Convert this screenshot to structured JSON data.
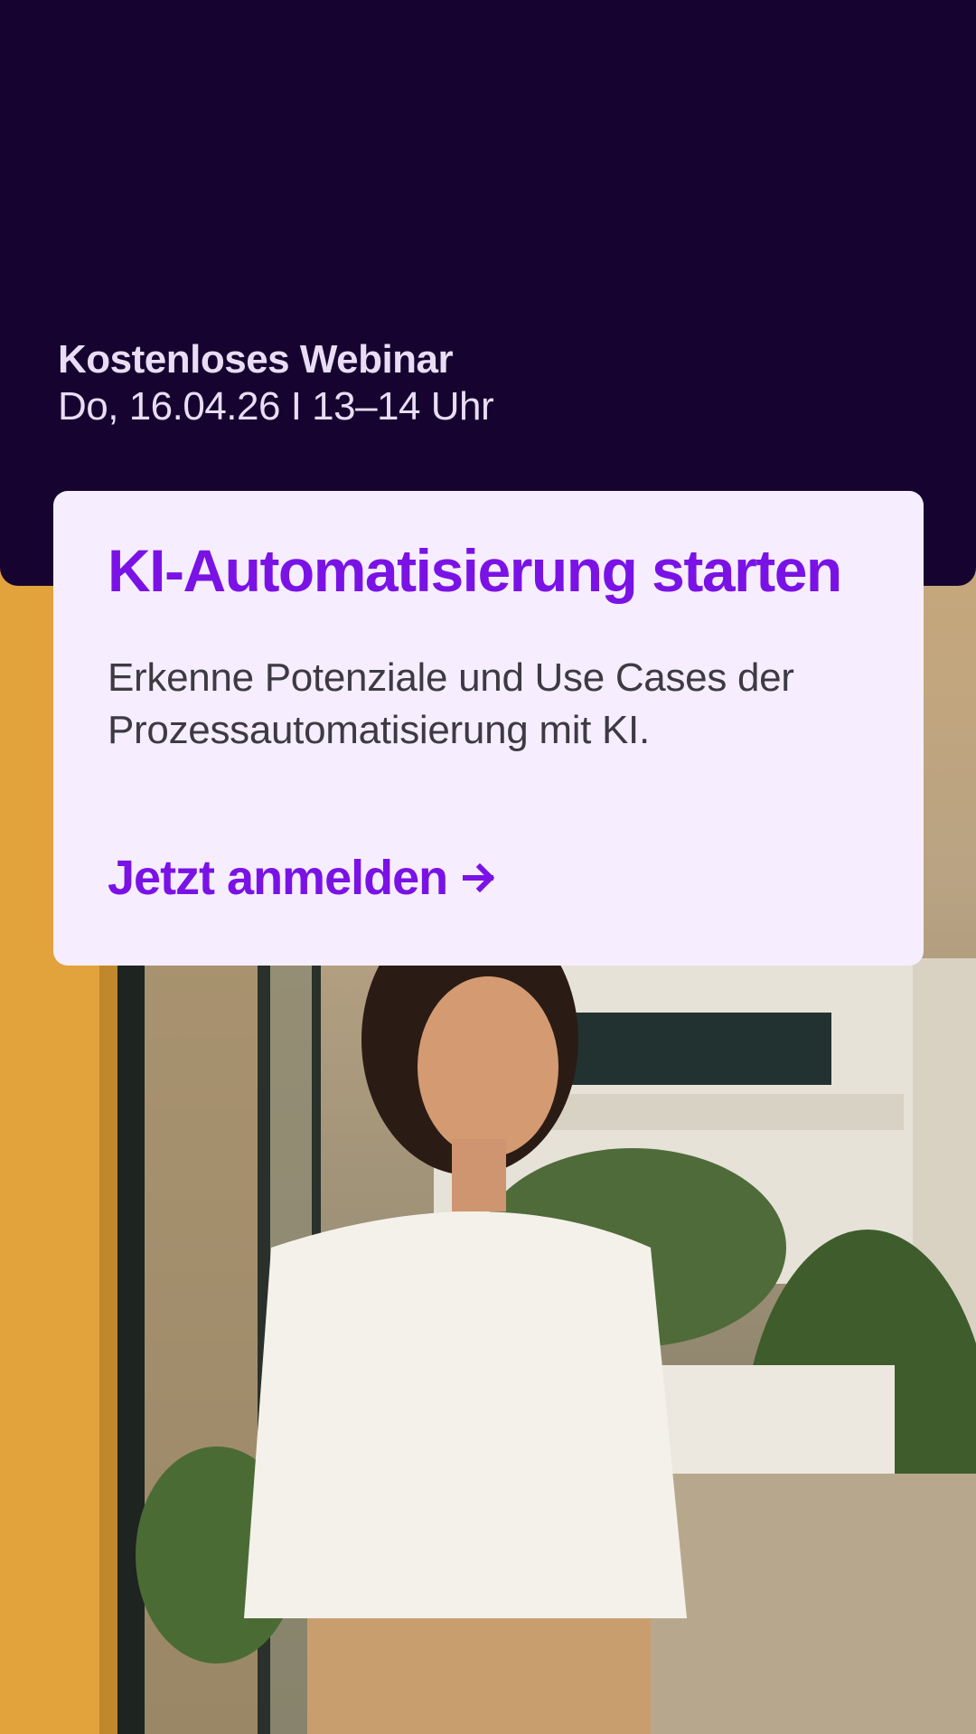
{
  "event": {
    "label": "Kostenloses Webinar",
    "datetime": "Do, 16.04.26 I 13–14 Uhr"
  },
  "card": {
    "title": "KI-Automatisierung starten",
    "description": "Erkenne Potenziale und Use Cases der Prozessautomatisierung mit KI.",
    "cta_label": "Jetzt anmelden",
    "cta_icon": "arrow-right-icon"
  },
  "colors": {
    "header_background": "#16032f",
    "card_background": "#f6eeff",
    "accent": "#7a12e6",
    "eyebrow_text": "#e9dcf5",
    "body_text": "#3d3a44"
  },
  "image": {
    "subject": "photo-woman-smiling-outdoors"
  }
}
